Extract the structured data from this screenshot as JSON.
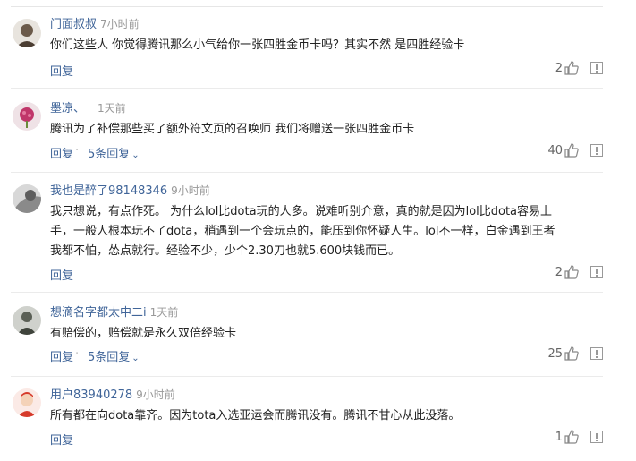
{
  "comments": [
    {
      "username": "门面叔叔",
      "time": "7小时前",
      "lines": [
        "你们这些人 你觉得腾讯那么小气给你一张四胜金币卡吗？其实不然 是四胜经验卡"
      ],
      "reply_label": "回复",
      "replies_label": "",
      "likes": "2",
      "avatar_color": "#6b5a4a"
    },
    {
      "username": "墨凉、",
      "time": "1天前",
      "lines": [
        "腾讯为了补偿那些买了额外符文页的召唤师 我们将赠送一张四胜金币卡"
      ],
      "reply_label": "回复",
      "replies_label": "5条回复",
      "likes": "40",
      "avatar_color": "#c0366a"
    },
    {
      "username": "我也是醉了98148346",
      "time": "9小时前",
      "lines": [
        "我只想说，有点作死。 为什么lol比dota玩的人多。说难听别介意，真的就是因为lol比dota容易上",
        "手，一般人根本玩不了dota，稍遇到一个会玩点的，能压到你怀疑人生。lol不一样，白金遇到王者",
        "我都不怕，怂点就行。经验不少，少个2.30刀也就5.600块钱而已。"
      ],
      "reply_label": "回复",
      "replies_label": "",
      "likes": "2",
      "avatar_color": "#8a8a8a"
    },
    {
      "username": "想滴名字都太中二i",
      "time": "1天前",
      "lines": [
        "有赔偿的，赔偿就是永久双倍经验卡"
      ],
      "reply_label": "回复",
      "replies_label": "5条回复",
      "likes": "25",
      "avatar_color": "#5a5f55"
    },
    {
      "username": "用户83940278",
      "time": "9小时前",
      "lines": [
        "所有都在向dota靠齐。因为tota入选亚运会而腾讯没有。腾讯不甘心从此没落。"
      ],
      "reply_label": "回复",
      "replies_label": "",
      "likes": "1",
      "avatar_color": "#d63a2a"
    }
  ],
  "colors": {
    "username": "#406599",
    "time": "#999999",
    "text": "#222222",
    "divider": "#ebebeb"
  },
  "icons": {
    "like": "thumbs-up-icon",
    "report": "report-icon"
  }
}
